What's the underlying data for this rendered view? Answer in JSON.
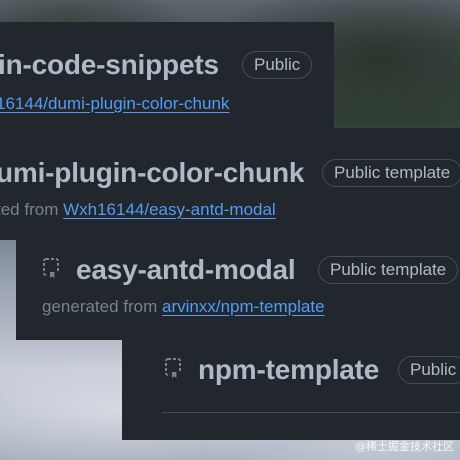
{
  "repos": [
    {
      "name": "in-code-snippets",
      "badge": "Public",
      "source_link": "16144/dumi-plugin-color-chunk"
    },
    {
      "name": "umi-plugin-color-chunk",
      "badge": "Public template",
      "source_prefix": "ted from",
      "source_link": "Wxh16144/easy-antd-modal"
    },
    {
      "name": "easy-antd-modal",
      "badge": "Public template",
      "source_prefix": "generated from",
      "source_link": "arvinxx/npm-template"
    },
    {
      "name": "npm-template",
      "badge": "Public"
    }
  ],
  "watermark": "@稀土掘金技术社区",
  "icon_names": [
    "repo-template-icon",
    "repo-template-icon"
  ],
  "colors": {
    "card_bg": "#22272e",
    "title": "#adbac7",
    "muted": "#768390",
    "link": "#539bf5",
    "border": "#444c56"
  }
}
